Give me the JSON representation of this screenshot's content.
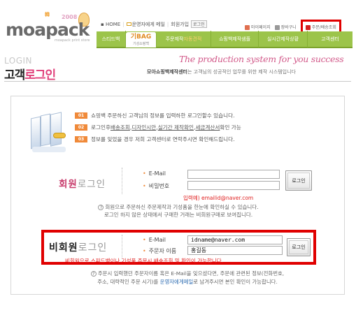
{
  "header": {
    "logo_text": "moapack",
    "logo_year": "2008",
    "logo_sub": "韓",
    "logo_tag": "moapack print store",
    "top_nav": {
      "home": "HOME",
      "ops_mail": "운영자에게 메일",
      "join": "회원가입",
      "login": "로그인"
    },
    "user_nav": {
      "mypage": "마이페이지",
      "cart": "장바구니",
      "order_shipping": "주문/배송조회"
    },
    "green_nav": [
      {
        "label": "스티드백"
      },
      {
        "label_big": "기BAG",
        "label_small": "기성쇼핑백"
      },
      {
        "label_prefix": "주문제작",
        "label_accent": "자동견적"
      },
      {
        "label": "쇼핑백제작샘플"
      },
      {
        "label": "실시간제작상황"
      },
      {
        "label": "고객센터"
      }
    ]
  },
  "page": {
    "title_en": "LOGIN",
    "title_ko_black": "고객",
    "title_ko_pink": "로그인",
    "slogan": "The production system for you success",
    "subtitle_bold": "모아쇼핑백제작센터",
    "subtitle_rest": "는 고객님의 성공적인 업무를 위한 제작 시스템입니다"
  },
  "info": [
    {
      "num": "01",
      "text": "쇼핑백 주문하신 고객님의 정보를 입력하한 로그인할수 있습니다."
    },
    {
      "num": "02",
      "pre": "로그인후 ",
      "u1": "배송조회",
      "m1": ", ",
      "u2": "디자인시안",
      "m2": ", ",
      "u3": "실기간 제작확인",
      "m3": ", ",
      "u4": "세금계산서",
      "post": " 확인 가능"
    },
    {
      "num": "03",
      "text": "정보를 잊었을 경우 저희 고객센터로 연락주시면 확인해드립니다."
    }
  ],
  "member_login": {
    "title_pink": "회원",
    "title_gray": "로그인",
    "email_label": "E-Mail",
    "password_label": "비밀번호",
    "email_value": "",
    "password_value": "",
    "button": "로그인",
    "example": "입력예) emailid@naver.com",
    "help_line1": "회원으로 주문하신 주문제작과 기성품을 한눈에 확인하실 수 있습니다.",
    "help_line2": "로그인 하지 않은 상태에서 구매한 거래는 비회원구매로 보여집니다."
  },
  "guest_login": {
    "title_black": "비회원",
    "title_gray": "로그인",
    "email_label": "E-Mail",
    "name_label": "주문자 이름",
    "email_value": "idname@naver.com",
    "name_value": "홍길동",
    "button": "로그인",
    "red_note": "비회원으로 스피드백이나 기성품 주문시 배송조회 및 확인이 가능합니다.",
    "help_line1": "주문시 입력했던 주문자이름 혹은 E-Mail을 잊으셨다면, 주문에 관련된 정보(전화번호,",
    "help_line2_pre": "주소, 대략적인 주문 시기)를 ",
    "help_line2_link": "운영자에게메일",
    "help_line2_post": "로 남겨주시면 본인 확인이 가능합니다."
  },
  "colors": {
    "nav_green": "#9cc44a",
    "accent_pink": "#e0407a",
    "accent_orange": "#f08a3a",
    "highlight_red": "#e00000"
  }
}
